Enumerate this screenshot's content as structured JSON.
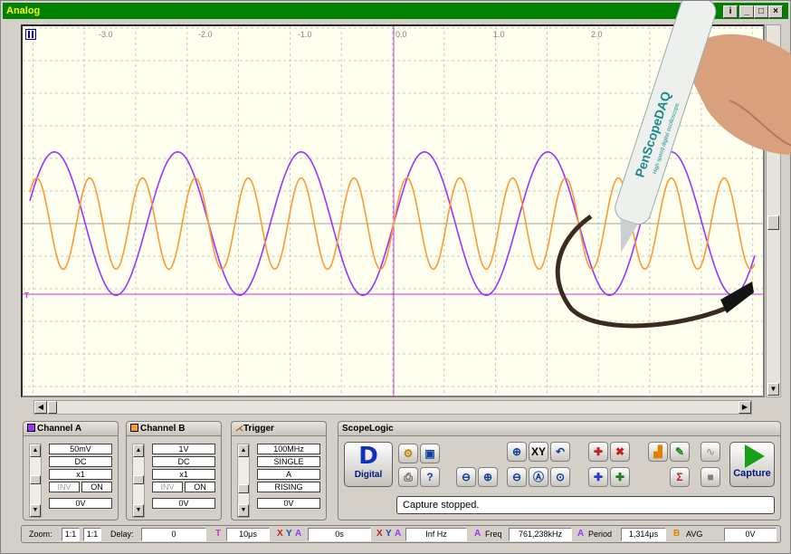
{
  "window": {
    "title": "Analog",
    "info_btn": "i",
    "min_btn": "_",
    "max_btn": "□",
    "close_btn": "×"
  },
  "colors": {
    "channel_a": "#9933ff",
    "channel_b": "#ff9933",
    "title_bg": "#008000",
    "title_fg": "#ffff00",
    "trigger_line": "#cc33cc"
  },
  "plot": {
    "x_ticks": [
      "-3.0",
      "-2.0",
      "-1.0",
      "0.0",
      "1.0",
      "2.0"
    ],
    "marker_t": "T"
  },
  "chart_data": {
    "type": "line",
    "xlim": [
      -3.6,
      3.6
    ],
    "x_ticks": [
      -3.0,
      -2.0,
      -1.0,
      0.0,
      1.0,
      2.0
    ],
    "grid": true,
    "series": [
      {
        "name": "Channel A",
        "color": "#9933ff",
        "waveform": "sine",
        "periods_visible": 6,
        "amplitude_divs": 2.2,
        "offset_divs": 0
      },
      {
        "name": "Channel B",
        "color": "#ff9933",
        "waveform": "sine",
        "periods_visible": 14,
        "amplitude_divs": 1.4,
        "offset_divs": 0
      }
    ]
  },
  "channel_a": {
    "title": "Channel A",
    "volts": "50mV",
    "coupling": "DC",
    "probe": "x1",
    "inv": "INV",
    "on": "ON",
    "offset": "0V"
  },
  "channel_b": {
    "title": "Channel B",
    "volts": "1V",
    "coupling": "DC",
    "probe": "x1",
    "inv": "INV",
    "on": "ON",
    "offset": "0V"
  },
  "trigger": {
    "title": "Trigger",
    "bandwidth": "100MHz",
    "mode": "SINGLE",
    "source": "A",
    "edge": "RISING",
    "level": "0V"
  },
  "scopelogic": {
    "title": "ScopeLogic",
    "digital_icon": "D",
    "digital_label": "Digital",
    "capture_label": "Capture",
    "status": "Capture stopped.",
    "sigma": "Σ"
  },
  "bottom": {
    "zoom_label": "Zoom:",
    "zoom_x": "1:1",
    "zoom_y": "1:1",
    "delay_label": "Delay:",
    "delay_val": "0",
    "t_label": "T",
    "t_val": "10μs",
    "x1": "X",
    "y1": "Y",
    "a1": "A",
    "dt_val": "0s",
    "x2": "X",
    "y2": "Y",
    "a2": "A",
    "freq_inv": "Inf Hz",
    "a3": "A",
    "freq_label": "Freq",
    "freq_val": "761,238kHz",
    "a4": "A",
    "period_label": "Period",
    "period_val": "1,314μs",
    "b_label": "B",
    "avg_label": "AVG",
    "avg_val": "0V"
  },
  "pen": {
    "brand": "PenScopeDAQ",
    "tagline": "High speed digital oscilloscope"
  }
}
